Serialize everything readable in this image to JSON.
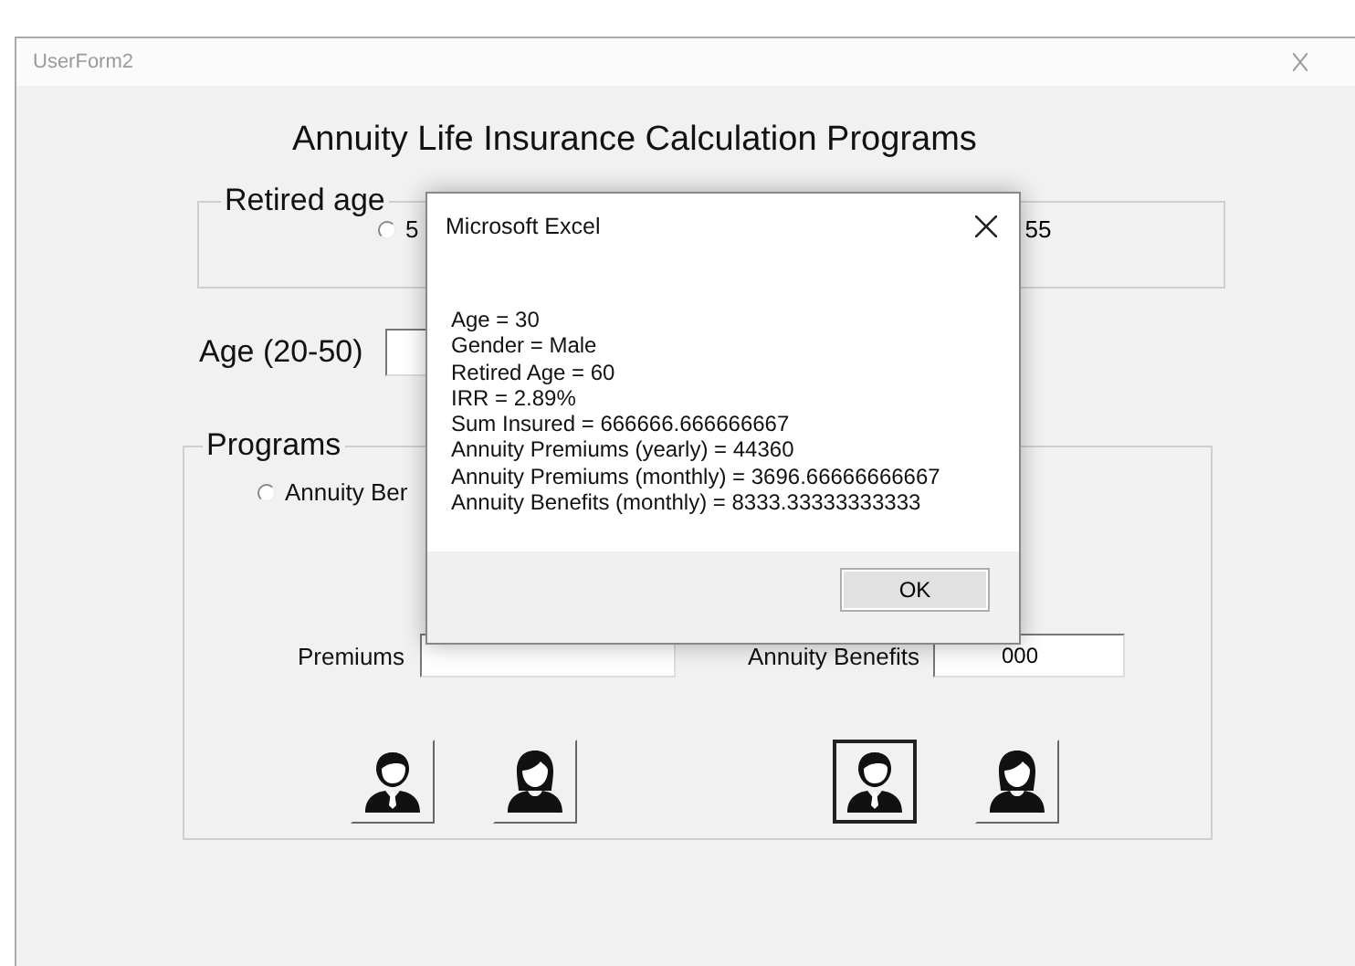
{
  "window": {
    "title": "UserForm2"
  },
  "heading": "Annuity Life Insurance Calculation Programs",
  "retired_age": {
    "label": "Retired age",
    "options": [
      {
        "kind": "radio",
        "label": "5",
        "selected": false
      },
      {
        "kind": "text",
        "label": "55"
      }
    ]
  },
  "age": {
    "label": "Age (20-50)"
  },
  "programs": {
    "label": "Programs",
    "option": {
      "label": "Annuity Ber",
      "selected": false
    },
    "premiums_label": "Premiums",
    "benefits_label": "Annuity Benefits",
    "benefits_value": "000",
    "premium_genders": [
      {
        "kind": "male",
        "selected": false
      },
      {
        "kind": "female",
        "selected": false
      }
    ],
    "benefit_genders": [
      {
        "kind": "male",
        "selected": true
      },
      {
        "kind": "female",
        "selected": false
      }
    ]
  },
  "dialog": {
    "title": "Microsoft Excel",
    "lines": [
      "Age = 30",
      "Gender = Male",
      "Retired Age = 60",
      "IRR = 2.89%",
      "Sum Insured = 666666.666666667",
      "Annuity Premiums (yearly) = 44360",
      "Annuity Premiums (monthly) = 3696.66666666667",
      "Annuity Benefits (monthly) = 8333.33333333333"
    ],
    "buttons": [
      "OK"
    ]
  }
}
